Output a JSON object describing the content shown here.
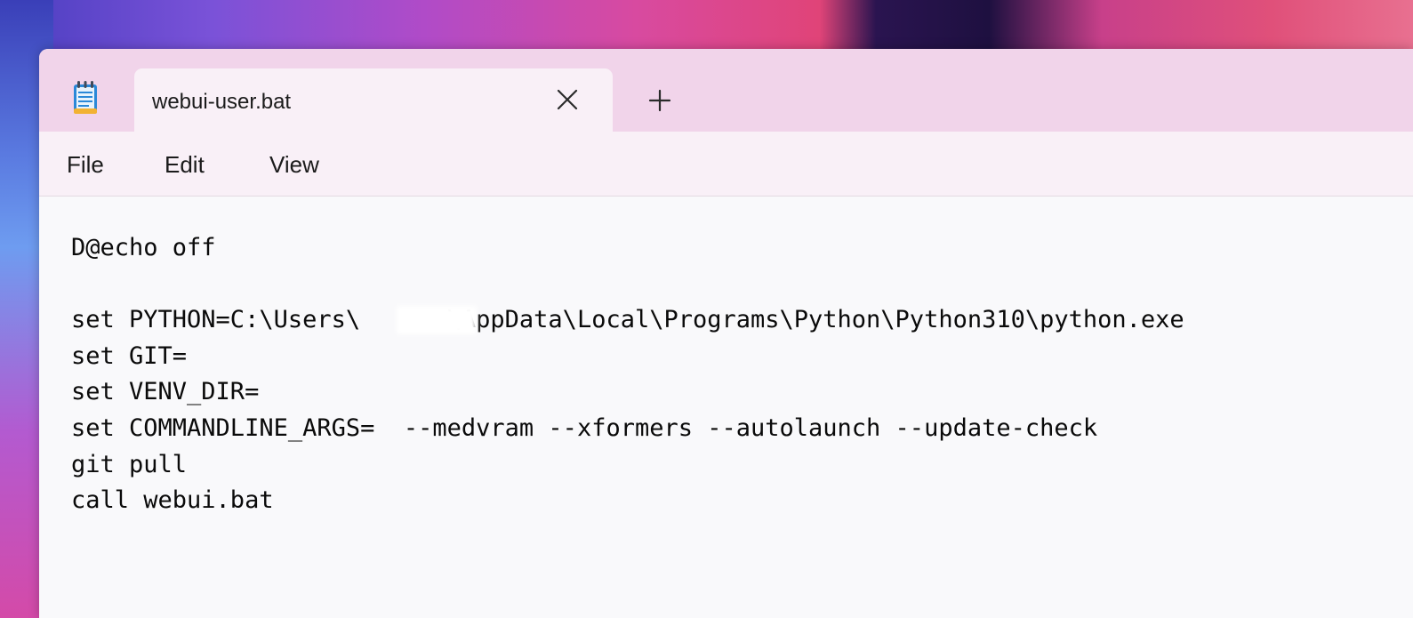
{
  "window": {
    "tab_title": "webui-user.bat",
    "icons": {
      "app": "notepad-icon",
      "close": "close-icon",
      "new_tab": "plus-icon"
    }
  },
  "menu": {
    "items": [
      {
        "label": "File"
      },
      {
        "label": "Edit"
      },
      {
        "label": "View"
      }
    ]
  },
  "editor": {
    "lines": [
      "D@echo off",
      "",
      "set PYTHON=C:\\Users\\      \\AppData\\Local\\Programs\\Python\\Python310\\python.exe",
      "set GIT=",
      "set VENV_DIR=",
      "set COMMANDLINE_ARGS=  --medvram --xformers --autolaunch --update-check",
      "git pull",
      "call webui.bat"
    ]
  }
}
